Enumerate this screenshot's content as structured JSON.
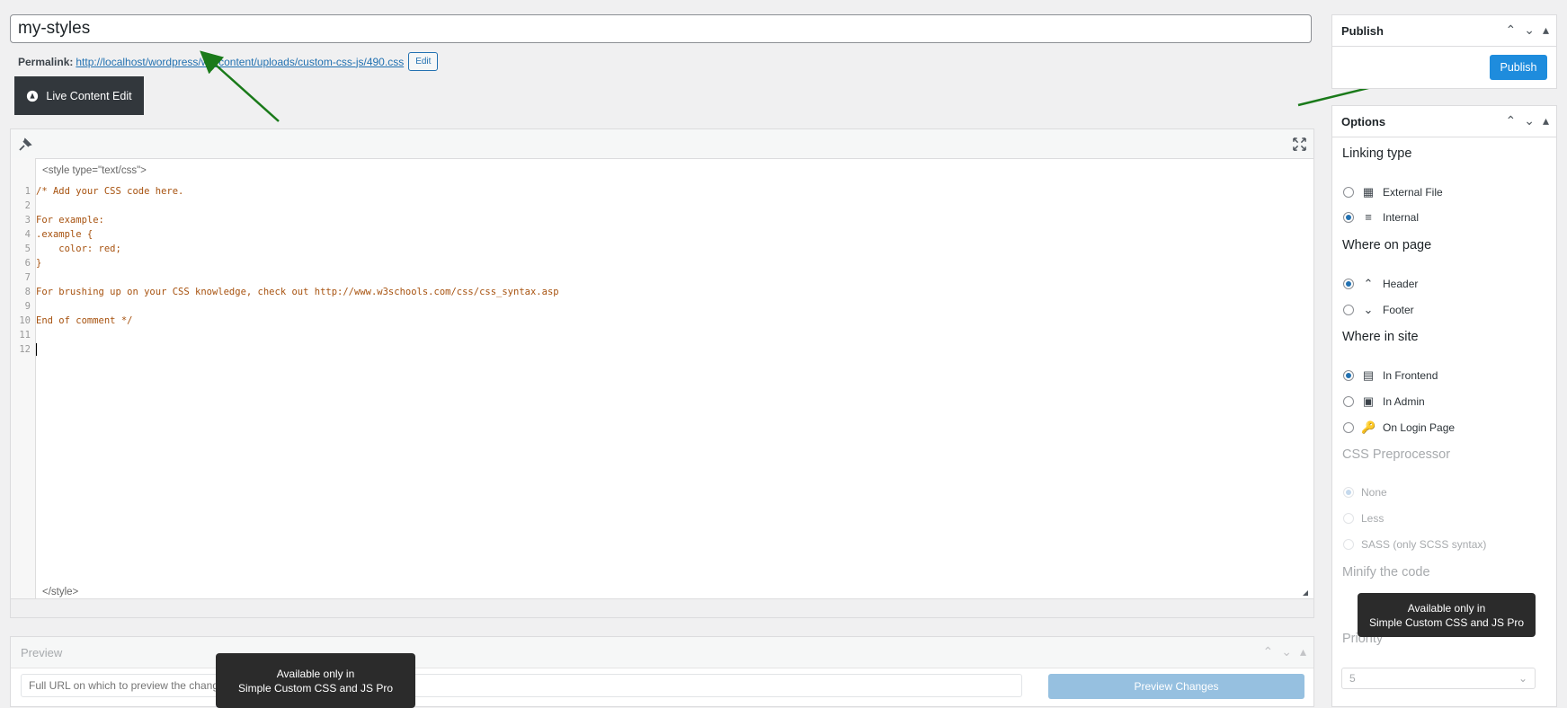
{
  "title": {
    "value": "my-styles"
  },
  "permalink": {
    "label": "Permalink:",
    "url": "http://localhost/wordpress/wp-content/uploads/custom-css-js/490.css",
    "edit_label": "Edit"
  },
  "live_edit": {
    "label": "Live Content Edit"
  },
  "editor": {
    "open_tag": "<style type=\"text/css\">",
    "close_tag": "</style>",
    "lines": [
      "/* Add your CSS code here.",
      "",
      "For example:",
      ".example {",
      "    color: red;",
      "}",
      "",
      "For brushing up on your CSS knowledge, check out http://www.w3schools.com/css/css_syntax.asp",
      "",
      "End of comment */",
      "",
      ""
    ],
    "line_numbers": [
      "1",
      "2",
      "3",
      "4",
      "5",
      "6",
      "7",
      "8",
      "9",
      "10",
      "11",
      "12"
    ]
  },
  "preview": {
    "title": "Preview",
    "url_placeholder": "Full URL on which to preview the changes ...",
    "button_label": "Preview Changes"
  },
  "tooltip": {
    "line1": "Available only in",
    "line2": "Simple Custom CSS and JS Pro"
  },
  "publish": {
    "title": "Publish",
    "button_label": "Publish"
  },
  "options": {
    "title": "Options",
    "linking_type": {
      "heading": "Linking type",
      "external": "External File",
      "internal": "Internal"
    },
    "where_on_page": {
      "heading": "Where on page",
      "header": "Header",
      "footer": "Footer"
    },
    "where_in_site": {
      "heading": "Where in site",
      "frontend": "In Frontend",
      "admin": "In Admin",
      "login": "On Login Page"
    },
    "preprocessor": {
      "heading": "CSS Preprocessor",
      "none": "None",
      "less": "Less",
      "sass": "SASS (only SCSS syntax)"
    },
    "minify": {
      "heading": "Minify the code"
    },
    "priority": {
      "heading": "Priority",
      "value": "5"
    }
  },
  "colors": {
    "accent": "#2271b1",
    "publish": "#1e8cdd",
    "comment": "#a7520f",
    "annotation_arrow": "#1a7a1a"
  }
}
